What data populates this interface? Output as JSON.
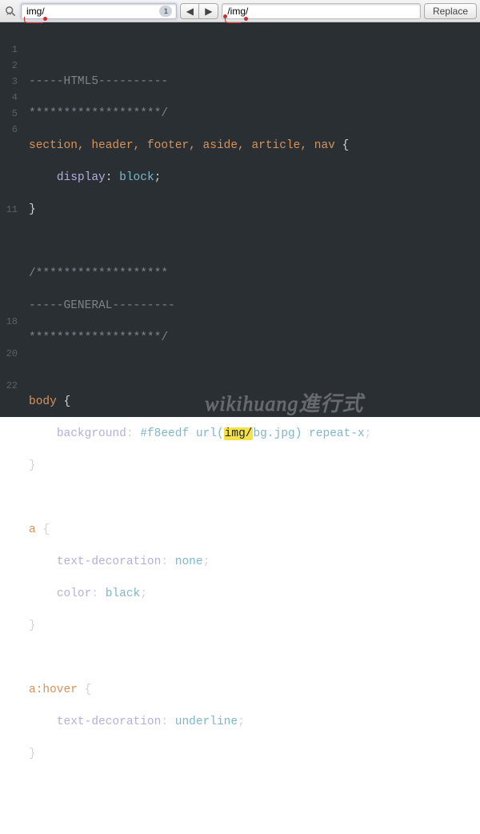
{
  "toolbar": {
    "search_value": "img/",
    "match_count": "1",
    "prev_label": "◀",
    "next_label": "▶",
    "replace_value": "/img/",
    "replace_button": "Replace"
  },
  "gutter": [
    "",
    "1",
    "2",
    "3",
    "4",
    "5",
    "6",
    "",
    "",
    "",
    "",
    "11",
    "",
    "",
    "",
    "",
    "",
    "",
    "18",
    "",
    "20",
    "",
    "22",
    "",
    ""
  ],
  "code": {
    "c1": "-----HTML5----------",
    "c2": "*******************/",
    "sel1": "section, header, footer, aside, article, nav ",
    "br_open": "{",
    "prop_display": "display",
    "val_block": "block",
    "br_close": "}",
    "c3": "/*******************",
    "c4": "-----GENERAL---------",
    "c5": "*******************/",
    "sel_body": "body ",
    "prop_bg": "background",
    "hex": "#f8eedf",
    "url_l": "url(",
    "match": "img/",
    "url_r": "bg.jpg)",
    "repeat": "repeat-x",
    "sel_a": "a ",
    "prop_td": "text-decoration",
    "val_none": "none",
    "prop_color": "color",
    "val_black": "black",
    "sel_ah": "a:hover ",
    "val_underline": "underline"
  },
  "watermark": "wikihuang進行式"
}
